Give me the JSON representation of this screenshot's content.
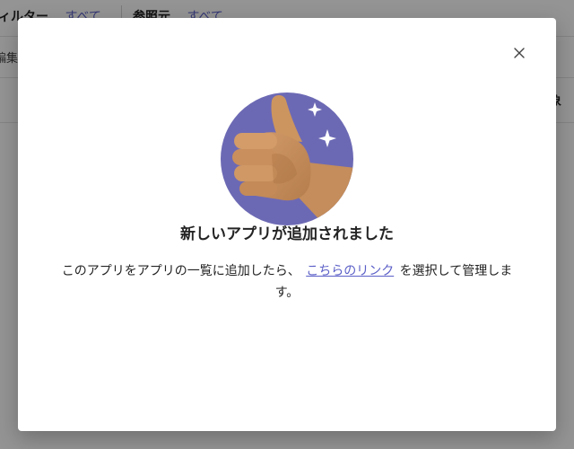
{
  "background": {
    "filter": {
      "label": "ィルター",
      "value": "すべて"
    },
    "source": {
      "label": "参照元",
      "value": "すべて"
    },
    "edit_label": "編集",
    "column_header_partial": "象"
  },
  "dialog": {
    "close_icon": "close-icon",
    "illustration_icon": "thumbs-up-icon",
    "title": "新しいアプリが追加されました",
    "body_before": "このアプリをアプリの一覧に追加したら、",
    "link_text": "こちらのリンク",
    "body_after": "を選択して管理します。"
  },
  "colors": {
    "accent": "#5b5fc7",
    "illustration_circle": "#6c69b4",
    "hand": "#c8915f",
    "overlay": "#6e6e6e"
  }
}
